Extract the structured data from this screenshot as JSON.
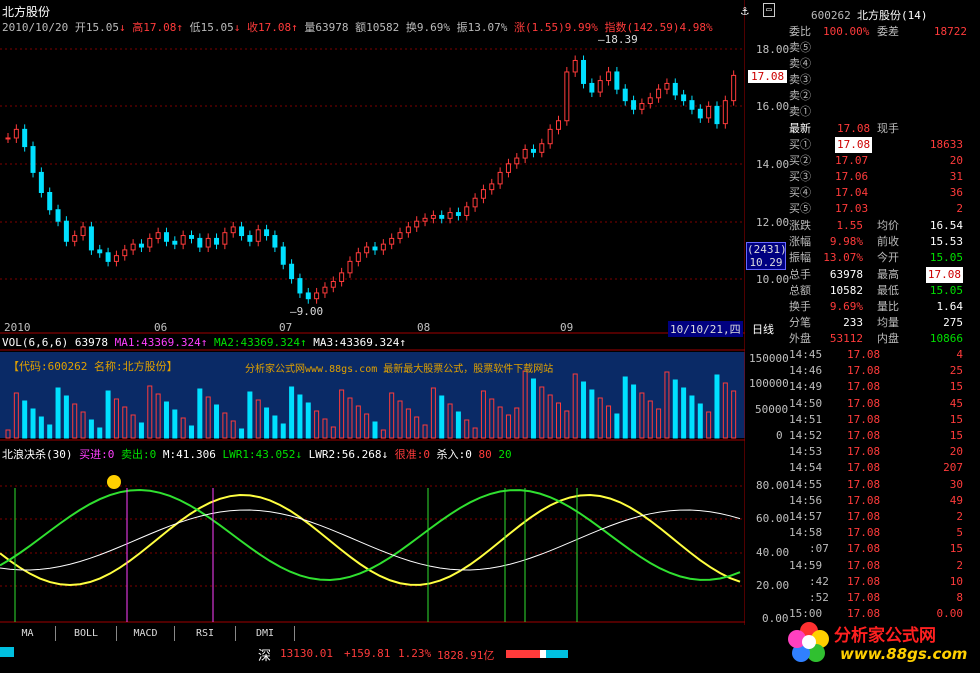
{
  "stock": {
    "title": "北方股份",
    "code": "600262",
    "name_full": "北方股份(14)"
  },
  "quote_line": {
    "date": "2010/10/20",
    "open": "开15.05",
    "high": "高17.08",
    "low": "低15.05",
    "close": "收17.08",
    "volume": "量63978",
    "amount": "额10582",
    "turnover": "换9.69%",
    "amplitude": "振13.07%",
    "change": "涨(1.55)9.99%",
    "index": "指数(142.59)4.98%"
  },
  "price_axis": [
    "18.00",
    "16.00",
    "14.00",
    "12.00",
    "10.00"
  ],
  "price_marks": {
    "high": "18.39",
    "low": "9.00",
    "current": "17.08",
    "box_a": "(2431)",
    "box_b": "10.29"
  },
  "time_axis": [
    "2010",
    "06",
    "07",
    "08",
    "09",
    "10/10/21,四"
  ],
  "period_label": "日线",
  "vol_header": {
    "label": "VOL(6,6,6)",
    "v": "63978",
    "ma1": "MA1:43369.324",
    "ma2": "MA2:43369.324",
    "ma3": "MA3:43369.324"
  },
  "vol_axis": [
    "150000",
    "100000",
    "50000",
    "0"
  ],
  "watermark": {
    "code": "【代码:600262 名称:北方股份】",
    "site": "分析家公式网www.88gs.com 最新最大股票公式，股票软件下载网站"
  },
  "ind_header": {
    "name": "北浪决杀(30)",
    "buy": "买进:0",
    "sell": "卖出:0",
    "m": "M:41.306",
    "lwr1": "LWR1:43.052",
    "lwr2": "LWR2:56.268",
    "hen": "很准:0",
    "sha": "杀入:0",
    "v80": "80",
    "v20": "20"
  },
  "ind_axis": [
    "80.00",
    "60.00",
    "40.00",
    "20.00",
    "0.00"
  ],
  "tabs": [
    "MA",
    "BOLL",
    "MACD",
    "RSI",
    "DMI"
  ],
  "status": {
    "market": "深",
    "index_value": "13130.01",
    "change": "+159.81",
    "pct": "1.23%",
    "amount": "1828.91亿"
  },
  "right_panel": {
    "header_code": "600262",
    "weibi": {
      "label": "委比",
      "value": "100.00%",
      "label2": "委差",
      "value2": "18722"
    },
    "sells": [
      {
        "label": "卖⑤"
      },
      {
        "label": "卖④"
      },
      {
        "label": "卖③"
      },
      {
        "label": "卖②"
      },
      {
        "label": "卖①"
      }
    ],
    "latest": {
      "label": "最新",
      "value": "17.08",
      "label2": "现手"
    },
    "buys": [
      {
        "label": "买①",
        "price": "17.08",
        "qty": "18633"
      },
      {
        "label": "买②",
        "price": "17.07",
        "qty": "20"
      },
      {
        "label": "买③",
        "price": "17.06",
        "qty": "31"
      },
      {
        "label": "买④",
        "price": "17.04",
        "qty": "36"
      },
      {
        "label": "买⑤",
        "price": "17.03",
        "qty": "2"
      }
    ],
    "stats": [
      {
        "l1": "涨跌",
        "v1": "1.55",
        "l2": "均价",
        "v2": "16.54"
      },
      {
        "l1": "涨幅",
        "v1": "9.98%",
        "l2": "前收",
        "v2": "15.53"
      },
      {
        "l1": "振幅",
        "v1": "13.07%",
        "l2": "今开",
        "v2": "15.05"
      },
      {
        "l1": "总手",
        "v1": "63978",
        "l2": "最高",
        "v2": "17.08"
      },
      {
        "l1": "总额",
        "v1": "10582",
        "l2": "最低",
        "v2": "15.05"
      },
      {
        "l1": "换手",
        "v1": "9.69%",
        "l2": "量比",
        "v2": "1.64"
      },
      {
        "l1": "分笔",
        "v1": "233",
        "l2": "均量",
        "v2": "275"
      },
      {
        "l1": "外盘",
        "v1": "53112",
        "l2": "内盘",
        "v2": "10866"
      }
    ],
    "ticks": [
      {
        "t": "14:45",
        "p": "17.08",
        "q": "4"
      },
      {
        "t": "14:46",
        "p": "17.08",
        "q": "25"
      },
      {
        "t": "14:49",
        "p": "17.08",
        "q": "15"
      },
      {
        "t": "14:50",
        "p": "17.08",
        "q": "45"
      },
      {
        "t": "14:51",
        "p": "17.08",
        "q": "15"
      },
      {
        "t": "14:52",
        "p": "17.08",
        "q": "15"
      },
      {
        "t": "14:53",
        "p": "17.08",
        "q": "20"
      },
      {
        "t": "14:54",
        "p": "17.08",
        "q": "207"
      },
      {
        "t": "14:55",
        "p": "17.08",
        "q": "30"
      },
      {
        "t": "14:56",
        "p": "17.08",
        "q": "49"
      },
      {
        "t": "14:57",
        "p": "17.08",
        "q": "2"
      },
      {
        "t": "14:58",
        "p": "17.08",
        "q": "5"
      },
      {
        "t": ":07",
        "p": "17.08",
        "q": "15"
      },
      {
        "t": "14:59",
        "p": "17.08",
        "q": "2"
      },
      {
        "t": ":42",
        "p": "17.08",
        "q": "10"
      },
      {
        "t": ":52",
        "p": "17.08",
        "q": "8"
      },
      {
        "t": "15:00",
        "p": "17.08",
        "q": "0.00"
      }
    ]
  },
  "logo": {
    "text": "分析家公式网",
    "url": "www.88gs.com"
  },
  "colors": {
    "up": "#ff3b3b",
    "down": "#00e0ff",
    "grid": "#a00000",
    "bg": "#000000"
  }
}
